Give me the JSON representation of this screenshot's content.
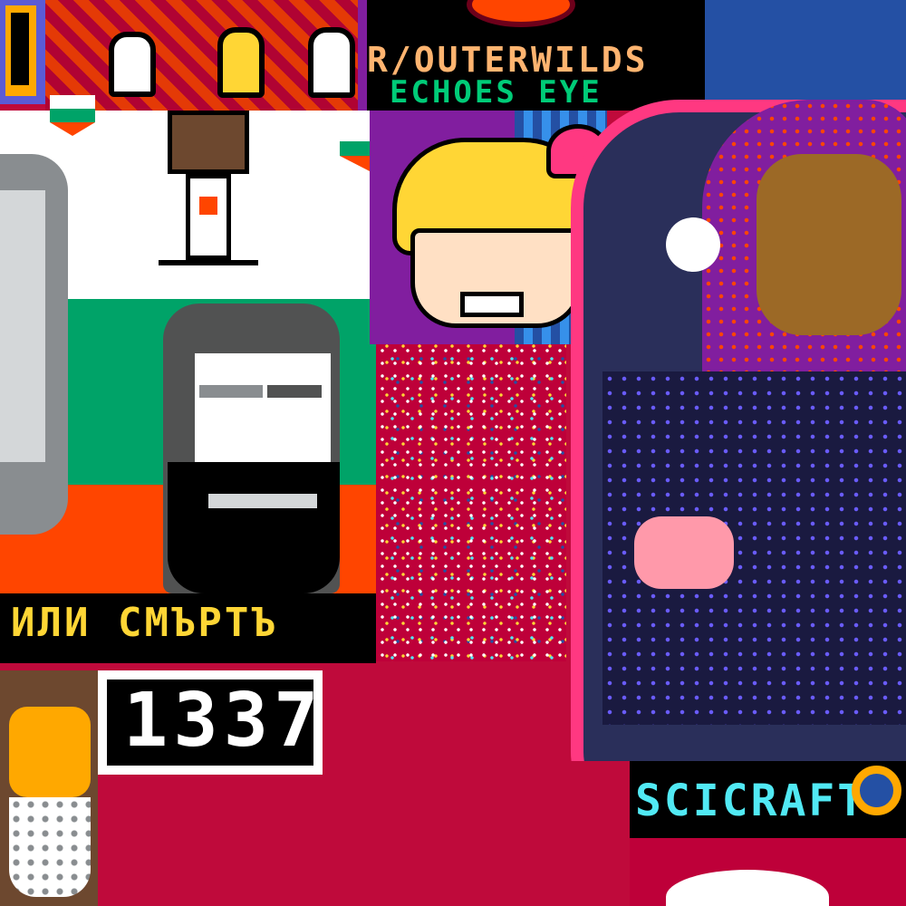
{
  "canvas": {
    "title_banner": "R/OUTERWILDS",
    "subtitle_banner": "ECHOES EYE",
    "cyrillic_motto": "ИЛИ СМЪРТЪ",
    "leet_number": "1337",
    "scicraft_label": "SCICRAFT"
  },
  "colors": {
    "bg_red": "#bf0a3b",
    "green": "#00a368",
    "orange": "#ff4500",
    "white": "#ffffff",
    "black": "#000000",
    "pink": "#ff3881",
    "yellow": "#ffd635",
    "navy": "#2a2f5a",
    "purple": "#811e9f",
    "blue": "#2450a4",
    "cyan": "#51e9f4"
  }
}
